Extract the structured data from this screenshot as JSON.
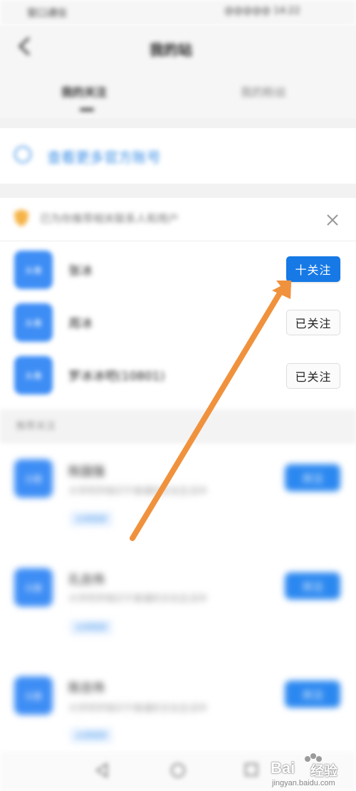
{
  "status_bar": {
    "left": "窗口通信",
    "right": "@@@@@ 14:22"
  },
  "header": {
    "title": "我的站",
    "tabs": [
      "我的关注",
      "我的粉丝"
    ]
  },
  "link": {
    "text": "查看更多官方账号"
  },
  "recommend": {
    "text": "已为你推荐相关联系人和用户"
  },
  "accounts": [
    {
      "avatar": "头像",
      "name": "张冰",
      "button": "十关注"
    },
    {
      "avatar": "头像",
      "name": "周冰",
      "button": "已关注"
    },
    {
      "avatar": "头像",
      "name": "罗冰冰吧(10801)",
      "button": "已关注"
    }
  ],
  "section": {
    "label": "推荐关注"
  },
  "suggestions": [
    {
      "avatar": "头像",
      "name": "陈国强",
      "desc": "大学同学相识于普通的文化生活中",
      "tag": "大学同学",
      "button": "关注"
    },
    {
      "avatar": "头像",
      "name": "孔志伟",
      "desc": "大学同学相识于普通的文化生活中",
      "tag": "大学同学",
      "button": "关注"
    },
    {
      "avatar": "头像",
      "name": "陈志伟",
      "desc": "大学同学相识于普通的文化生活中",
      "tag": "大学同学",
      "button": "关注"
    }
  ],
  "watermark": {
    "brand": "Bai",
    "suffix": "经验",
    "url": "jingyan.baidu.com"
  },
  "colors": {
    "primary": "#1679e6",
    "arrow": "#f0923d",
    "link": "#3a8ee6"
  }
}
